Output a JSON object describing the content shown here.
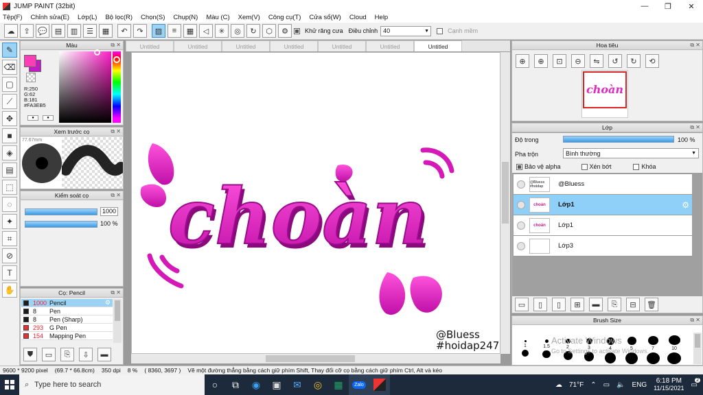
{
  "window": {
    "title": "JUMP PAINT (32bit)",
    "min": "—",
    "max": "❐",
    "close": "✕"
  },
  "menu": [
    "Tệp(F)",
    "Chỉnh sửa(E)",
    "Lớp(L)",
    "Bộ lọc(R)",
    "Chọn(S)",
    "Chụp(N)",
    "Màu (C)",
    "Xem(V)",
    "Công cụ(T)",
    "Cửa sổ(W)",
    "Cloud",
    "Help"
  ],
  "toolbar": {
    "antialias_label": "Khử răng cưa",
    "adjust_label": "Điều chỉnh",
    "adjust_value": "40",
    "snap_label": "Cạnh mềm"
  },
  "color_panel": {
    "title": "Màu",
    "r": "R:250",
    "g": "G:62",
    "b": "B:181",
    "hex": "#FA3EB5",
    "primary": "#FA3EB5",
    "secondary": "#C21AC4"
  },
  "brush_preview": {
    "title": "Xem trước cọ",
    "size_text": "77.67mm"
  },
  "brush_control": {
    "title": "Kiểm soát cọ",
    "size": "1000",
    "opacity": "100 %"
  },
  "brush_list": {
    "title": "Cọ: Pencil",
    "items": [
      {
        "num": "1000",
        "name": "Pencil",
        "color": "#1c1c1c"
      },
      {
        "num": "8",
        "name": "Pen",
        "color": "#1c1c1c"
      },
      {
        "num": "8",
        "name": "Pen (Sharp)",
        "color": "#1c1c1c"
      },
      {
        "num": "293",
        "name": "G Pen",
        "color": "#e83030"
      },
      {
        "num": "154",
        "name": "Mapping Pen",
        "color": "#e83030"
      }
    ]
  },
  "tabs": [
    "Untitled",
    "Untitled",
    "Untitled",
    "Untitled",
    "Untitled",
    "Untitled",
    "Untitled"
  ],
  "canvas": {
    "word": "choàn",
    "signature_line1": "@Bluess",
    "signature_line2": "#hoidap247"
  },
  "navigator": {
    "title": "Hoa tiêu",
    "thumb_word": "choàn"
  },
  "layers_panel": {
    "title": "Lớp",
    "opacity_label": "Độ trong",
    "opacity_value": "100 %",
    "blend_label": "Pha trộn",
    "blend_value": "Bình thường",
    "protect_alpha": "Bảo vệ alpha",
    "clip": "Xén bớt",
    "lock": "Khóa",
    "layers": [
      {
        "name": "@Bluess",
        "thumb": "@Bluess #hoidap"
      },
      {
        "name": "Lớp1",
        "thumb": "choàn"
      },
      {
        "name": "Lớp1",
        "thumb": "choàn"
      },
      {
        "name": "Lớp3",
        "thumb": ""
      }
    ]
  },
  "brush_size": {
    "title": "Brush Size",
    "sizes": [
      "1",
      "1.5",
      "2",
      "3",
      "4",
      "5",
      "7",
      "10"
    ]
  },
  "watermark": {
    "line1": "Activate Windows",
    "line2": "Go to Settings to activate Windows."
  },
  "status": {
    "dims": "9600 * 9200 pixel",
    "mm": "(69.7 * 66.8cm)",
    "dpi": "350 dpi",
    "zoom": "8 %",
    "coords": "( 8360, 3697 )",
    "hint": "Vẽ một đường thẳng bằng cách giữ phím Shift, Thay đổi cỡ cọ bằng cách giữ phím Ctrl, Alt và kéo"
  },
  "taskbar": {
    "search": "Type here to search",
    "weather": "71°F",
    "lang": "ENG",
    "time": "6:18 PM",
    "date": "11/15/2021",
    "badge": "2",
    "zalo": "Zalo"
  }
}
